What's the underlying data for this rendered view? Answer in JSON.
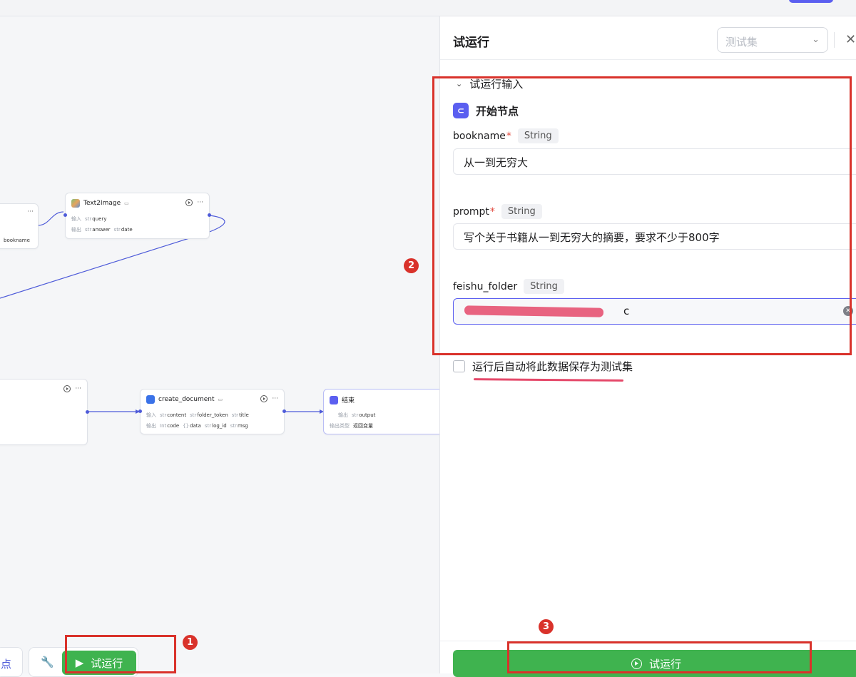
{
  "canvas": {
    "partial_node": {
      "output_label": "bookname"
    },
    "text2image": {
      "title": "Text2Image",
      "input_label": "输入",
      "input_params": [
        {
          "type": "str",
          "name": "query"
        }
      ],
      "output_label": "输出",
      "output_params": [
        {
          "type": "str",
          "name": "answer"
        },
        {
          "type": "str",
          "name": "date"
        }
      ]
    },
    "create_document": {
      "title": "create_document",
      "input_label": "输入",
      "input_params": [
        {
          "type": "str",
          "name": "content"
        },
        {
          "type": "str",
          "name": "folder_token"
        },
        {
          "type": "str",
          "name": "title"
        }
      ],
      "output_label": "输出",
      "output_params": [
        {
          "type": "Int",
          "name": "code"
        },
        {
          "type": "{}",
          "name": "data"
        },
        {
          "type": "str",
          "name": "log_id"
        },
        {
          "type": "str",
          "name": "msg"
        }
      ]
    },
    "end_node": {
      "title": "结束",
      "output_label": "输出",
      "output_param": {
        "type": "str",
        "name": "output"
      },
      "output_type_label": "输出类型",
      "output_type_value": "返回变量"
    },
    "more_glyph": "···"
  },
  "toolbar": {
    "partial_label": "点",
    "run_label": "试运行"
  },
  "panel": {
    "title": "试运行",
    "testset_placeholder": "测试集",
    "section_title": "试运行输入",
    "start_node_label": "开始节点",
    "fields": [
      {
        "name": "bookname",
        "required": true,
        "type": "String",
        "value": "从一到无穷大"
      },
      {
        "name": "prompt",
        "required": true,
        "type": "String",
        "value": "写个关于书籍从一到无穷大的摘要，要求不少于800字"
      },
      {
        "name": "feishu_folder",
        "required": false,
        "type": "String",
        "value": "c"
      }
    ],
    "checkbox_label": "运行后自动将此数据保存为测试集",
    "run_button_label": "试运行"
  },
  "annotations": [
    "1",
    "2",
    "3"
  ],
  "colors": {
    "accent": "#5b5ff0",
    "run_green": "#3fb34f",
    "annotation_red": "#d9322b",
    "redaction_pink": "#e5496a"
  }
}
